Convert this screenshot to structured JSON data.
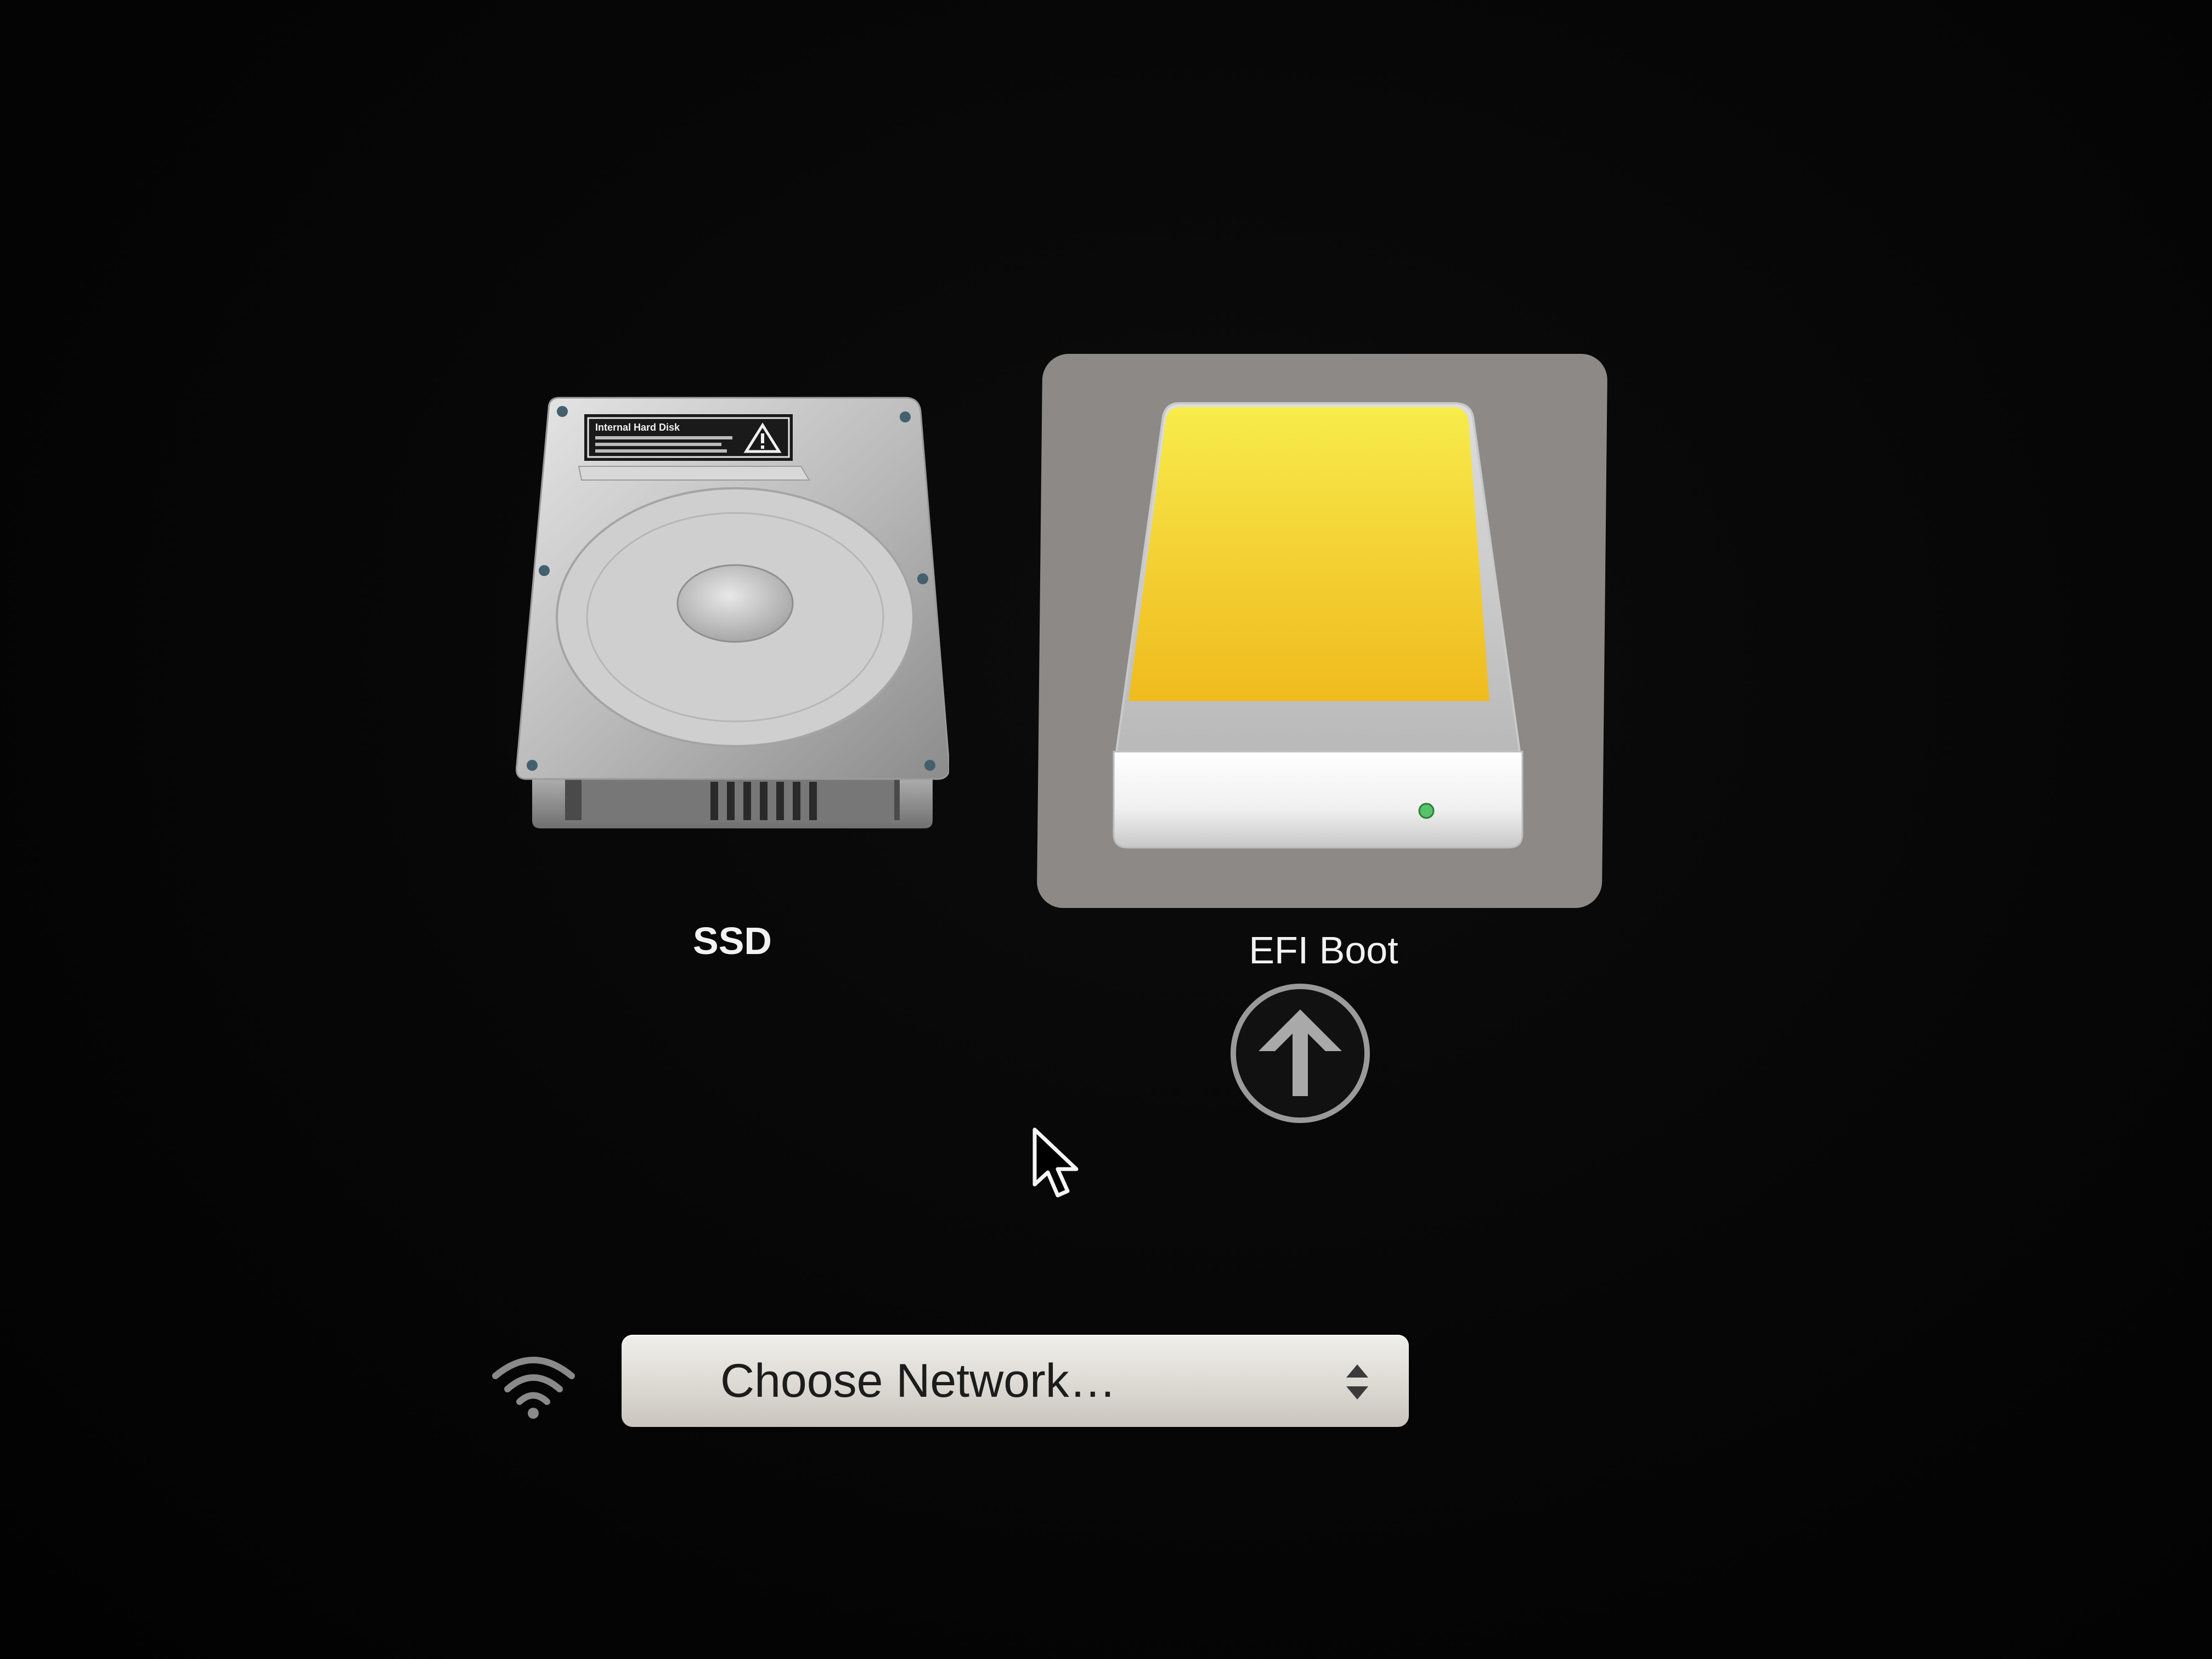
{
  "boot_picker": {
    "volumes": [
      {
        "label": "SSD",
        "icon": "internal-hard-disk-icon",
        "icon_sticker_title": "Internal Hard Disk",
        "selected": false
      },
      {
        "label": "EFI Boot",
        "icon": "external-drive-icon",
        "selected": true,
        "drive_color": "#f2c424"
      }
    ],
    "boot_button_icon": "up-arrow-circle-icon",
    "highlight_color": "#8d8986"
  },
  "network": {
    "icon": "wifi-icon",
    "select_label": "Choose Network…",
    "stepper_icon": "up-down-chevron-icon"
  },
  "pointer_icon": "mouse-pointer-icon"
}
